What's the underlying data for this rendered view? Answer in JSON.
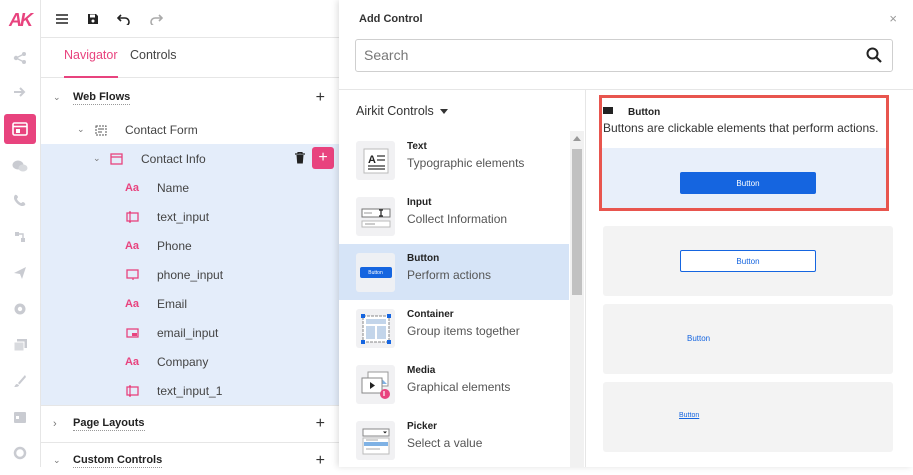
{
  "rail": {
    "logo": "AK"
  },
  "toolbar": {},
  "tabs": {
    "navigator": "Navigator",
    "controls": "Controls"
  },
  "tree": {
    "web_flows": "Web Flows",
    "contact_form": "Contact Form",
    "contact_info": "Contact Info",
    "items": [
      {
        "icon": "Aa",
        "label": "Name"
      },
      {
        "icon": "input",
        "label": "text_input"
      },
      {
        "icon": "Aa",
        "label": "Phone"
      },
      {
        "icon": "phone",
        "label": "phone_input"
      },
      {
        "icon": "Aa",
        "label": "Email"
      },
      {
        "icon": "email",
        "label": "email_input"
      },
      {
        "icon": "Aa",
        "label": "Company"
      },
      {
        "icon": "input",
        "label": "text_input_1"
      }
    ],
    "page_layouts": "Page Layouts",
    "custom_controls": "Custom Controls"
  },
  "dialog": {
    "title": "Add Control",
    "close": "×",
    "search_placeholder": "Search",
    "group": "Airkit Controls",
    "controls": [
      {
        "name": "Text",
        "desc": "Typographic elements"
      },
      {
        "name": "Input",
        "desc": "Collect Information"
      },
      {
        "name": "Button",
        "desc": "Perform actions",
        "thumb_label": "Button"
      },
      {
        "name": "Container",
        "desc": "Group items together"
      },
      {
        "name": "Media",
        "desc": "Graphical elements"
      },
      {
        "name": "Picker",
        "desc": "Select a value"
      }
    ],
    "preview": {
      "title": "Button",
      "desc": "Buttons are clickable elements that perform actions.",
      "variants": [
        "Button",
        "Button",
        "Button",
        "Button"
      ]
    }
  },
  "colors": {
    "accent": "#e8437e",
    "primary_button": "#1565e0",
    "highlight": "#e4edfa",
    "selected": "#d6e4f7",
    "callout": "#e8554e"
  }
}
